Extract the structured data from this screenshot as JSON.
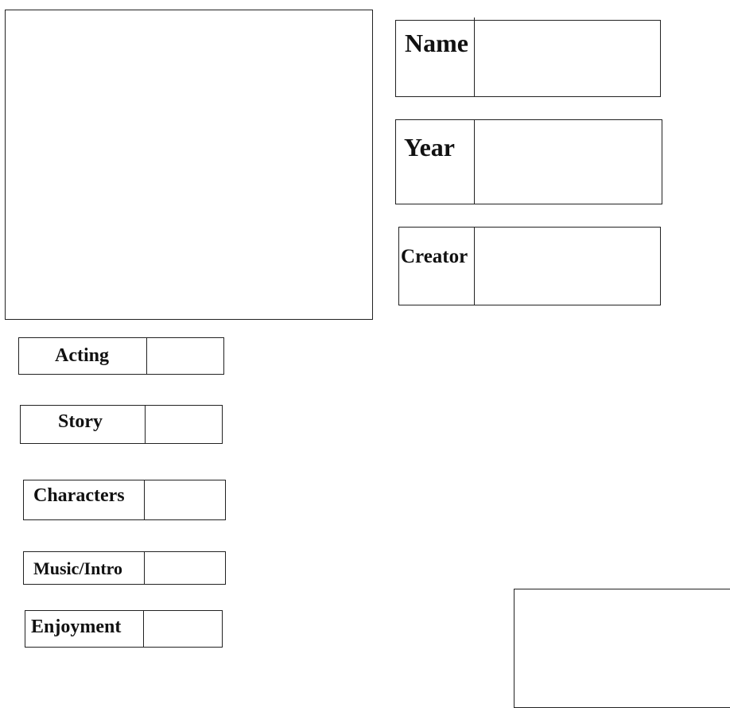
{
  "form": {
    "image_placeholder": "",
    "info_fields": [
      {
        "label": "Name",
        "value": ""
      },
      {
        "label": "Year",
        "value": ""
      },
      {
        "label": "Creator",
        "value": ""
      }
    ],
    "rating_fields": [
      {
        "label": "Acting",
        "value": ""
      },
      {
        "label": "Story",
        "value": ""
      },
      {
        "label": "Characters",
        "value": ""
      },
      {
        "label": "Music/Intro",
        "value": ""
      },
      {
        "label": "Enjoyment",
        "value": ""
      }
    ],
    "total_box": ""
  }
}
